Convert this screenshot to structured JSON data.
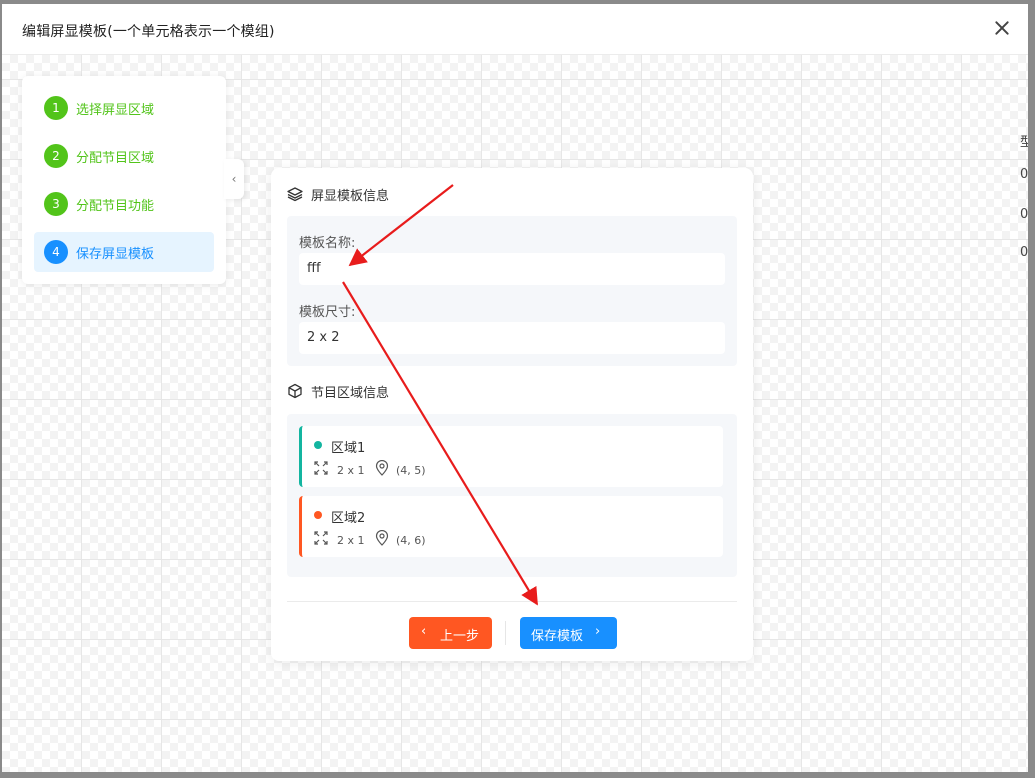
{
  "dialog": {
    "title": "编辑屏显模板(一个单元格表示一个模组)"
  },
  "steps": [
    {
      "num": "1",
      "label": "选择屏显区域"
    },
    {
      "num": "2",
      "label": "分配节目区域"
    },
    {
      "num": "3",
      "label": "分配节目功能"
    },
    {
      "num": "4",
      "label": "保存屏显模板"
    }
  ],
  "active_step": "4",
  "card": {
    "template_section_title": "屏显模板信息",
    "name_label": "模板名称:",
    "name_value": "fff",
    "size_label": "模板尺寸:",
    "size_value": "2 x 2",
    "region_section_title": "节目区域信息",
    "regions": [
      {
        "name": "区域1",
        "size": "2 x 1",
        "position": "(4, 5)",
        "color": "#13b5a0"
      },
      {
        "name": "区域2",
        "size": "2 x 1",
        "position": "(4, 6)",
        "color": "#ff5722"
      }
    ],
    "prev_label": "上一步",
    "save_label": "保存模板"
  },
  "icons": {
    "close": "close-icon",
    "collapse": "chevron-left-icon",
    "template_section": "layers-icon",
    "region_section": "cube-icon",
    "region_size": "expand-icon",
    "region_position": "location-pin-icon",
    "prev": "chevron-left-icon",
    "save": "chevron-right-icon"
  },
  "colors": {
    "step_done": "#52c41a",
    "step_active": "#1890ff",
    "prev_button": "#ff5722",
    "save_button": "#1890ff",
    "annotation_arrow": "#e81c1c"
  }
}
